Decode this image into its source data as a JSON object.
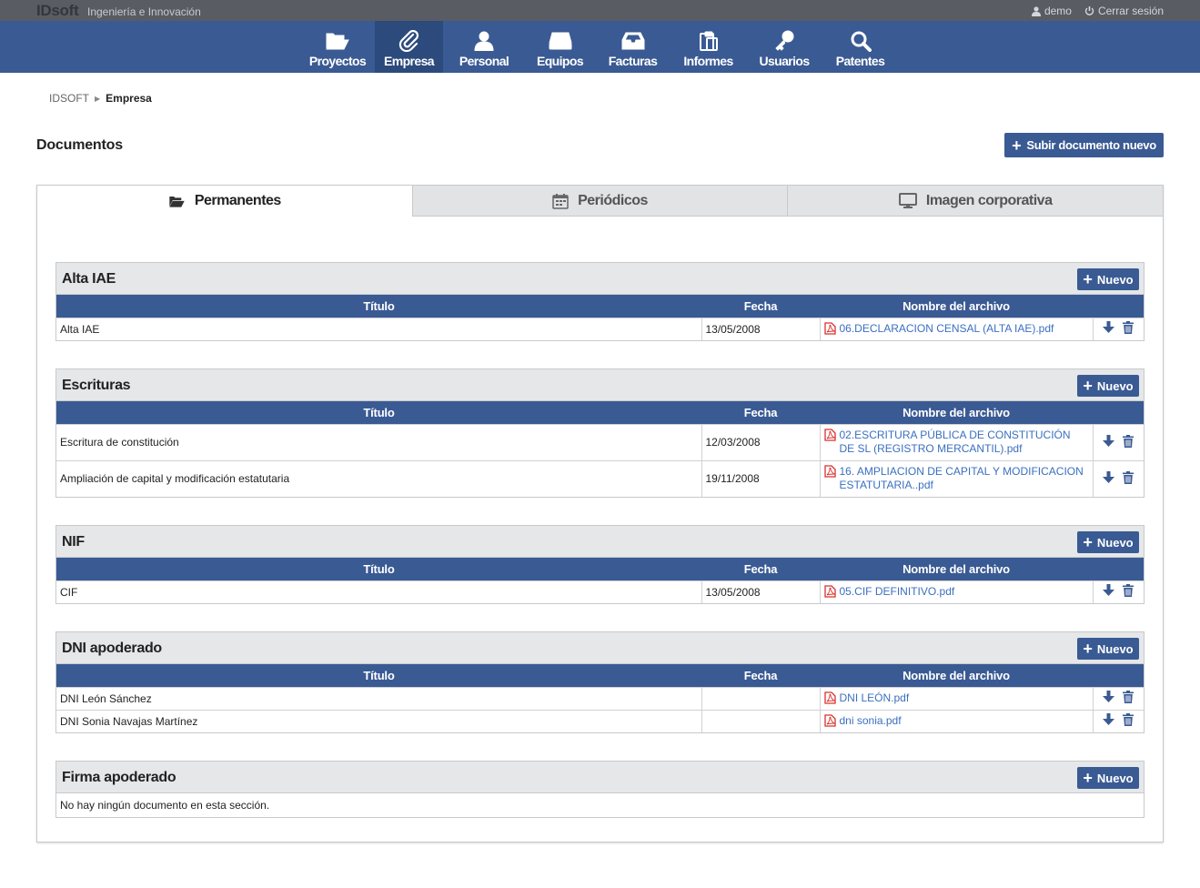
{
  "topbar": {
    "brand": "IDsoft",
    "tagline": "Ingeniería e Innovación",
    "user": "demo",
    "logout": "Cerrar sesión"
  },
  "nav": [
    {
      "label": "Proyectos",
      "icon": "folder-open-icon",
      "active": false
    },
    {
      "label": "Empresa",
      "icon": "paperclip-icon",
      "active": true
    },
    {
      "label": "Personal",
      "icon": "user-icon",
      "active": false
    },
    {
      "label": "Equipos",
      "icon": "hdd-icon",
      "active": false
    },
    {
      "label": "Facturas",
      "icon": "inbox-icon",
      "active": false
    },
    {
      "label": "Informes",
      "icon": "clipboard-icon",
      "active": false
    },
    {
      "label": "Usuarios",
      "icon": "key-icon",
      "active": false
    },
    {
      "label": "Patentes",
      "icon": "search-icon",
      "active": false
    }
  ],
  "breadcrumb": {
    "root": "IDSOFT",
    "current": "Empresa"
  },
  "page": {
    "title": "Documentos",
    "upload_label": "Subir documento nuevo"
  },
  "tabs": [
    {
      "label": "Permanentes",
      "icon": "folder-open-icon",
      "active": true
    },
    {
      "label": "Periódicos",
      "icon": "calendar-icon",
      "active": false
    },
    {
      "label": "Imagen corporativa",
      "icon": "monitor-icon",
      "active": false
    }
  ],
  "columns": {
    "title": "Título",
    "date": "Fecha",
    "file": "Nombre del archivo"
  },
  "new_label": "Nuevo",
  "sections": [
    {
      "title": "Alta IAE",
      "rows": [
        {
          "title": "Alta IAE",
          "date": "13/05/2008",
          "file": "06.DECLARACION CENSAL (ALTA IAE).pdf"
        }
      ]
    },
    {
      "title": "Escrituras",
      "rows": [
        {
          "title": "Escritura de constitución",
          "date": "12/03/2008",
          "file": "02.ESCRITURA PÚBLICA DE CONSTITUCIÓN DE SL (REGISTRO MERCANTIL).pdf"
        },
        {
          "title": "Ampliación de capital y modificación estatutaria",
          "date": "19/11/2008",
          "file": "16. AMPLIACION DE CAPITAL Y MODIFICACION ESTATUTARIA..pdf"
        }
      ]
    },
    {
      "title": "NIF",
      "rows": [
        {
          "title": "CIF",
          "date": "13/05/2008",
          "file": "05.CIF DEFINITIVO.pdf"
        }
      ]
    },
    {
      "title": "DNI apoderado",
      "rows": [
        {
          "title": "DNI León Sánchez",
          "date": "",
          "file": "DNI LEÓN.pdf"
        },
        {
          "title": "DNI Sonia Navajas Martínez",
          "date": "",
          "file": "dni sonia.pdf"
        }
      ]
    },
    {
      "title": "Firma apoderado",
      "rows": [],
      "empty_message": "No hay ningún documento en esta sección."
    }
  ],
  "colors": {
    "primary": "#3a5a93",
    "primary_dark": "#2c4a7c",
    "topbar": "#595c63",
    "link": "#3a6fc0",
    "pdf": "#d9302c"
  }
}
